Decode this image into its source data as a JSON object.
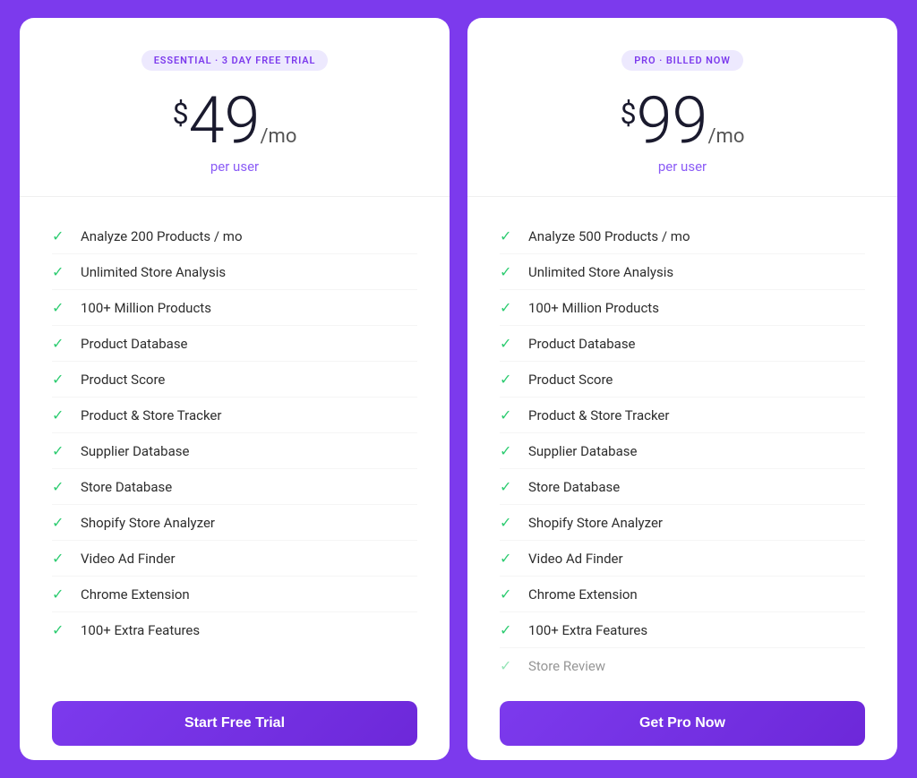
{
  "plans": [
    {
      "id": "essential",
      "badge": "ESSENTIAL · 3 DAY FREE TRIAL",
      "price": "49",
      "period": "/mo",
      "per_user": "per user",
      "currency": "$",
      "features": [
        "Analyze 200 Products / mo",
        "Unlimited Store Analysis",
        "100+ Million Products",
        "Product Database",
        "Product Score",
        "Product & Store Tracker",
        "Supplier Database",
        "Store Database",
        "Shopify Store Analyzer",
        "Video Ad Finder",
        "Chrome Extension",
        "100+ Extra Features"
      ],
      "cta": "Start Free Trial"
    },
    {
      "id": "pro",
      "badge": "PRO · BILLED NOW",
      "price": "99",
      "period": "/mo",
      "per_user": "per user",
      "currency": "$",
      "features": [
        "Analyze 500 Products / mo",
        "Unlimited Store Analysis",
        "100+ Million Products",
        "Product Database",
        "Product Score",
        "Product & Store Tracker",
        "Supplier Database",
        "Store Database",
        "Shopify Store Analyzer",
        "Video Ad Finder",
        "Chrome Extension",
        "100+ Extra Features",
        "Store Review"
      ],
      "cta": "Get Pro Now"
    }
  ]
}
